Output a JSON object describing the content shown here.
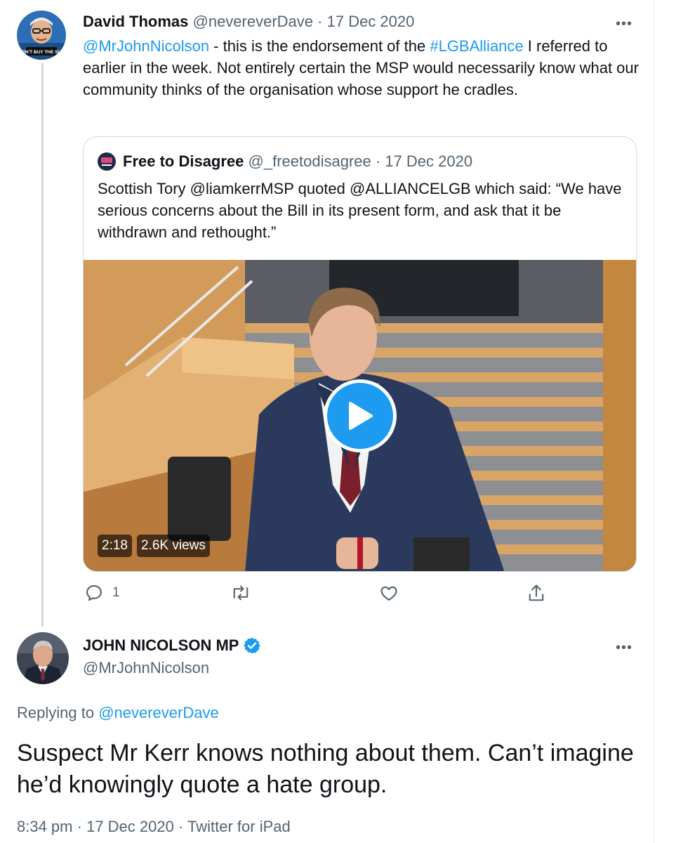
{
  "tweet1": {
    "display_name": "David Thomas",
    "handle": "@nevereverDave",
    "separator": "·",
    "date": "17 Dec 2020",
    "avatar_caption": "DON'T BUY THE SUN",
    "body": {
      "mention": "@MrJohnNicolson",
      "text_a": " - this is the endorsement of the ",
      "hashtag": "#LGBAlliance",
      "text_b": " I referred to earlier in the week. Not entirely certain the MSP would necessarily know what our community thinks of the organisation whose support he cradles."
    },
    "quote": {
      "display_name": "Free to Disagree",
      "handle": "@_freetodisagree",
      "separator": "·",
      "date": "17 Dec 2020",
      "text": "Scottish Tory @liamkerrMSP quoted @ALLIANCELGB which said: “We have serious concerns about the Bill in its present form, and ask that it be withdrawn and rethought.”",
      "video": {
        "duration": "2:18",
        "views": "2.6K views"
      }
    },
    "actions": {
      "reply_count": "1",
      "retweet_count": "",
      "like_count": ""
    }
  },
  "tweet2": {
    "display_name": "JOHN NICOLSON MP",
    "handle": "@MrJohnNicolson",
    "verified": true,
    "replying_prefix": "Replying to ",
    "replying_to": "@nevereverDave",
    "body": "Suspect Mr Kerr knows nothing about them. Can’t imagine he’d knowingly quote a hate group.",
    "time": "8:34 pm",
    "separator": "·",
    "date": "17 Dec 2020",
    "source": "Twitter for iPad"
  },
  "more_glyph": "•••",
  "colors": {
    "accent": "#1d9bf0",
    "text": "#0f1419",
    "muted": "#536471",
    "border": "#cfd9de"
  },
  "icons": [
    "reply-icon",
    "retweet-icon",
    "like-icon",
    "share-icon",
    "more-icon",
    "verified-badge-icon",
    "play-icon"
  ]
}
